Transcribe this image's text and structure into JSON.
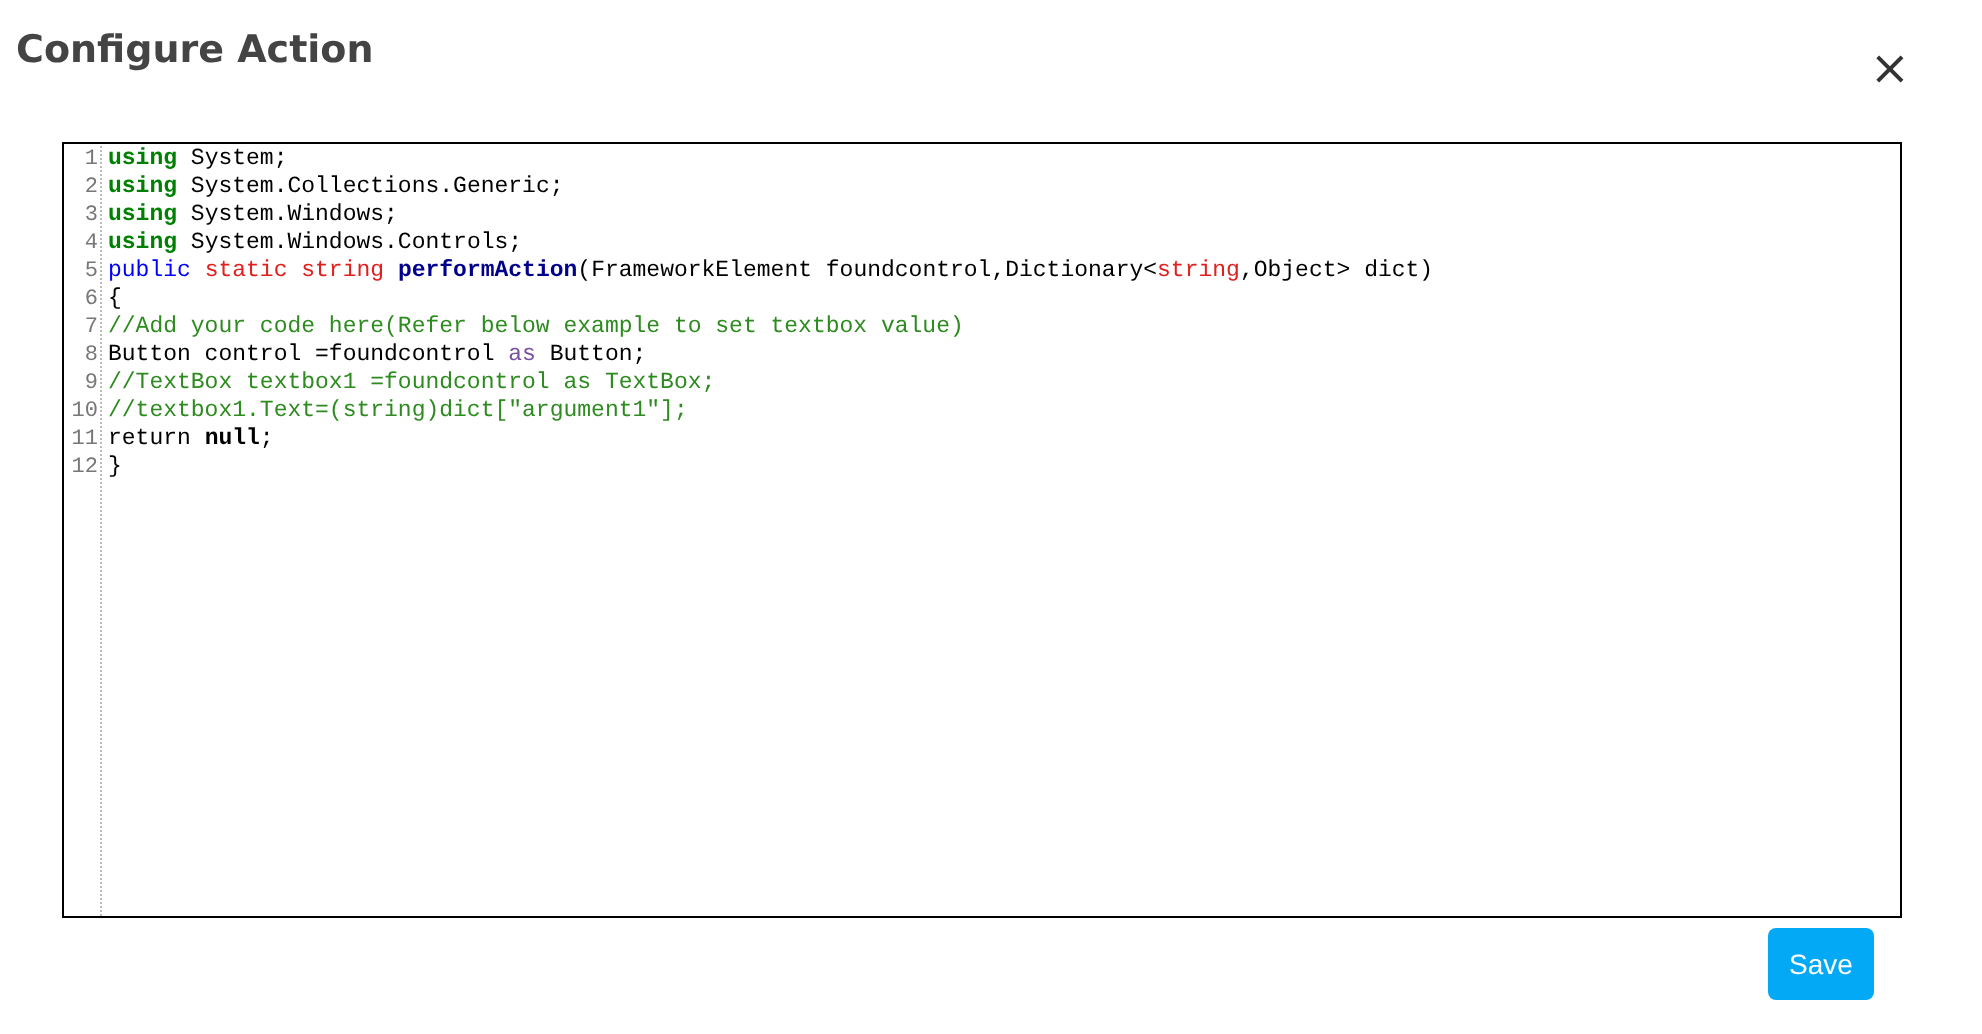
{
  "dialog": {
    "title": "Configure Action",
    "close": "×"
  },
  "editor": {
    "lines": [
      {
        "number": "1",
        "tokens": [
          {
            "kind": "keyword",
            "text": "using"
          },
          {
            "kind": "plain",
            "text": " System;"
          }
        ]
      },
      {
        "number": "2",
        "tokens": [
          {
            "kind": "keyword",
            "text": "using"
          },
          {
            "kind": "plain",
            "text": " System.Collections.Generic;"
          }
        ]
      },
      {
        "number": "3",
        "tokens": [
          {
            "kind": "keyword",
            "text": "using"
          },
          {
            "kind": "plain",
            "text": " System.Windows;"
          }
        ]
      },
      {
        "number": "4",
        "tokens": [
          {
            "kind": "keyword",
            "text": "using"
          },
          {
            "kind": "plain",
            "text": " System.Windows.Controls;"
          }
        ]
      },
      {
        "number": "5",
        "tokens": [
          {
            "kind": "modifier",
            "text": "public"
          },
          {
            "kind": "type",
            "text": " static string"
          },
          {
            "kind": "method",
            "text": " performAction"
          },
          {
            "kind": "plain",
            "text": "(FrameworkElement foundcontrol,Dictionary<"
          },
          {
            "kind": "type",
            "text": "string"
          },
          {
            "kind": "plain",
            "text": ",Object> dict)"
          }
        ]
      },
      {
        "number": "6",
        "tokens": [
          {
            "kind": "plain",
            "text": "{"
          }
        ]
      },
      {
        "number": "7",
        "tokens": [
          {
            "kind": "comment",
            "text": "//Add your code here(Refer below example to set textbox value)"
          }
        ]
      },
      {
        "number": "8",
        "tokens": [
          {
            "kind": "plain",
            "text": "Button control =foundcontrol "
          },
          {
            "kind": "operator",
            "text": "as"
          },
          {
            "kind": "plain",
            "text": " Button;"
          }
        ]
      },
      {
        "number": "9",
        "tokens": [
          {
            "kind": "comment",
            "text": "//TextBox textbox1 =foundcontrol as TextBox;"
          }
        ]
      },
      {
        "number": "10",
        "tokens": [
          {
            "kind": "comment",
            "text": "//textbox1.Text=(string)dict[\"argument1\"];"
          }
        ]
      },
      {
        "number": "11",
        "tokens": [
          {
            "kind": "plain",
            "text": "return "
          },
          {
            "kind": "literal",
            "text": "null"
          },
          {
            "kind": "plain",
            "text": ";"
          }
        ]
      },
      {
        "number": "12",
        "tokens": [
          {
            "kind": "plain",
            "text": "}"
          }
        ]
      }
    ]
  },
  "buttons": [
    {
      "label": "Save"
    }
  ]
}
